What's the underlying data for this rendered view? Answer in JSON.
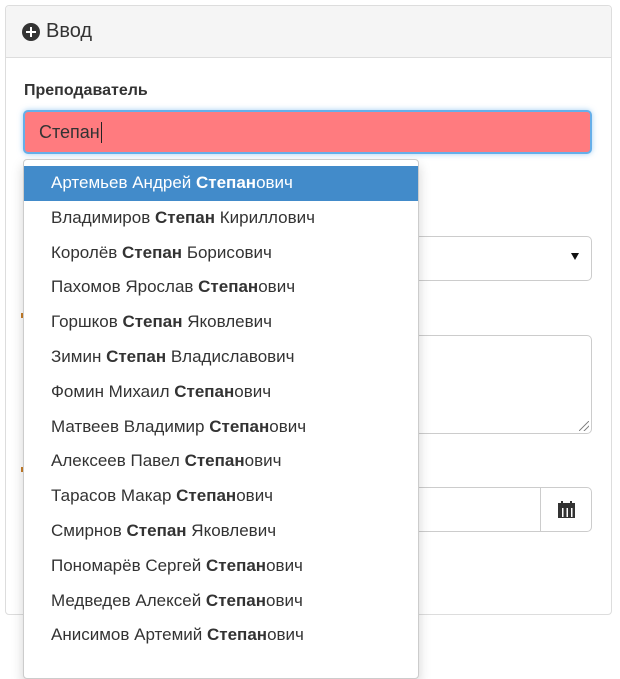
{
  "panel": {
    "title": "Ввод",
    "icon": "plus-circle-icon"
  },
  "teacher": {
    "label": "Преподаватель",
    "value": "Степан"
  },
  "suggestions": [
    {
      "pre": "Артемьев Андрей ",
      "match": "Степан",
      "post": "ович",
      "active": true
    },
    {
      "pre": "Владимиров ",
      "match": "Степан",
      "post": " Кириллович"
    },
    {
      "pre": "Королёв ",
      "match": "Степан",
      "post": " Борисович"
    },
    {
      "pre": "Пахомов Ярослав ",
      "match": "Степан",
      "post": "ович"
    },
    {
      "pre": "Горшков ",
      "match": "Степан",
      "post": " Яковлевич"
    },
    {
      "pre": "Зимин ",
      "match": "Степан",
      "post": " Владиславович"
    },
    {
      "pre": "Фомин Михаил ",
      "match": "Степан",
      "post": "ович"
    },
    {
      "pre": "Матвеев Владимир ",
      "match": "Степан",
      "post": "ович"
    },
    {
      "pre": "Алексеев Павел ",
      "match": "Степан",
      "post": "ович"
    },
    {
      "pre": "Тарасов Макар ",
      "match": "Степан",
      "post": "ович"
    },
    {
      "pre": "Смирнов ",
      "match": "Степан",
      "post": " Яковлевич"
    },
    {
      "pre": "Пономарёв Сергей ",
      "match": "Степан",
      "post": "ович"
    },
    {
      "pre": "Медведев Алексей ",
      "match": "Степан",
      "post": "ович"
    },
    {
      "pre": "Анисимов Артемий ",
      "match": "Степан",
      "post": "ович"
    }
  ],
  "colors": {
    "error_fill": "#ff7b7f",
    "focus_border": "#66afe9",
    "active_item": "#428bca"
  }
}
